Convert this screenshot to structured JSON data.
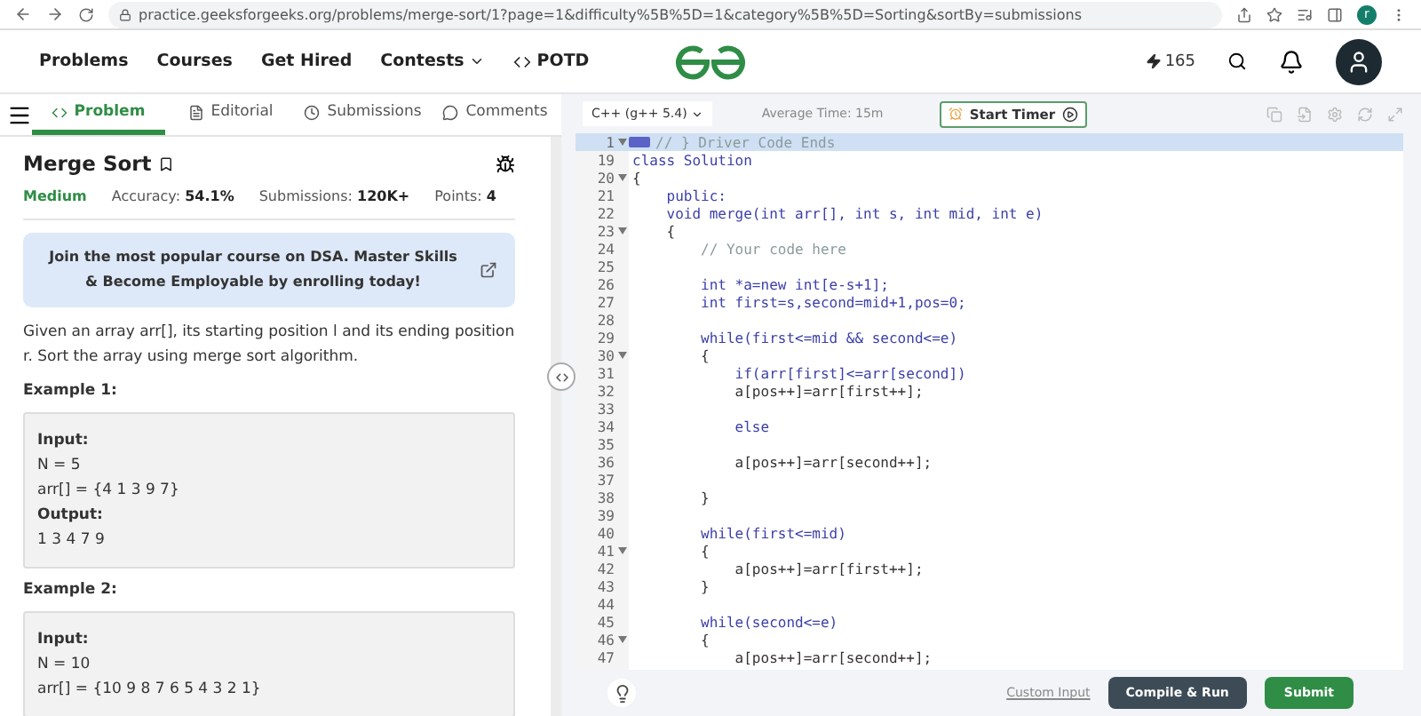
{
  "browser": {
    "url": "practice.geeksforgeeks.org/problems/merge-sort/1?page=1&difficulty%5B%5D=1&category%5B%5D=Sorting&sortBy=submissions",
    "profile_initial": "r"
  },
  "nav": {
    "links": [
      {
        "label": "Problems",
        "kind": "plain"
      },
      {
        "label": "Courses",
        "kind": "plain"
      },
      {
        "label": "Get Hired",
        "kind": "plain"
      },
      {
        "label": "Contests",
        "kind": "dropdown"
      },
      {
        "label": "POTD",
        "kind": "code"
      }
    ],
    "streak": "165"
  },
  "tabs": [
    {
      "label": "Problem",
      "kind": "code",
      "selected": true
    },
    {
      "label": "Editorial",
      "kind": "doc",
      "selected": false
    },
    {
      "label": "Submissions",
      "kind": "clock",
      "selected": false
    },
    {
      "label": "Comments",
      "kind": "chat",
      "selected": false
    }
  ],
  "problem": {
    "title": "Merge Sort",
    "difficulty": "Medium",
    "stats": [
      {
        "label": "Accuracy:",
        "value": "54.1%"
      },
      {
        "label": "Submissions:",
        "value": "120K+"
      },
      {
        "label": "Points:",
        "value": "4"
      }
    ],
    "banner": "Join the most popular course on DSA. Master Skills & Become Employable by enrolling today!",
    "description": "Given an array arr[], its starting position l and its ending position r. Sort the array using merge sort algorithm.",
    "examples": [
      {
        "heading": "Example 1:",
        "lines": [
          {
            "text": "Input:",
            "kind": "label"
          },
          {
            "text": "N = 5",
            "kind": "value"
          },
          {
            "text": "arr[] = {4 1 3 9 7}",
            "kind": "value"
          },
          {
            "text": "Output:",
            "kind": "label"
          },
          {
            "text": "1 3 4 7 9",
            "kind": "value"
          }
        ]
      },
      {
        "heading": "Example 2:",
        "lines": [
          {
            "text": "Input:",
            "kind": "label"
          },
          {
            "text": "N = 10",
            "kind": "value"
          },
          {
            "text": "arr[] = {10 9 8 7 6 5 4 3 2 1}",
            "kind": "value"
          }
        ]
      }
    ]
  },
  "editor": {
    "language": "C++ (g++ 5.4)",
    "average_time": "Average Time: 15m",
    "timer_button": "Start Timer",
    "lines": [
      {
        "number": "1",
        "text": "// } Driver Code Ends",
        "kind": "comment",
        "foldable": true,
        "active": true
      },
      {
        "number": "19",
        "text": "class Solution",
        "kind": "keyword",
        "foldable": false,
        "active": false
      },
      {
        "number": "20",
        "text": "{",
        "kind": "plain",
        "foldable": true,
        "active": false
      },
      {
        "number": "21",
        "text": "    public:",
        "kind": "keyword",
        "foldable": false,
        "active": false
      },
      {
        "number": "22",
        "text": "    void merge(int arr[], int s, int mid, int e)",
        "kind": "keyword",
        "foldable": false,
        "active": false
      },
      {
        "number": "23",
        "text": "    {",
        "kind": "plain",
        "foldable": true,
        "active": false
      },
      {
        "number": "24",
        "text": "        // Your code here",
        "kind": "comment",
        "foldable": false,
        "active": false
      },
      {
        "number": "25",
        "foldable": false,
        "active": false
      },
      {
        "number": "26",
        "text": "        int *a=new int[e-s+1];",
        "kind": "keyword",
        "foldable": false,
        "active": false
      },
      {
        "number": "27",
        "text": "        int first=s,second=mid+1,pos=0;",
        "kind": "keyword",
        "foldable": false,
        "active": false
      },
      {
        "number": "28",
        "foldable": false,
        "active": false
      },
      {
        "number": "29",
        "text": "        while(first<=mid && second<=e)",
        "kind": "keyword",
        "foldable": false,
        "active": false
      },
      {
        "number": "30",
        "text": "        {",
        "kind": "plain",
        "foldable": true,
        "active": false
      },
      {
        "number": "31",
        "text": "            if(arr[first]<=arr[second])",
        "kind": "keyword",
        "foldable": false,
        "active": false
      },
      {
        "number": "32",
        "text": "            a[pos++]=arr[first++];",
        "kind": "plain",
        "foldable": false,
        "active": false
      },
      {
        "number": "33",
        "foldable": false,
        "active": false
      },
      {
        "number": "34",
        "text": "            else",
        "kind": "keyword",
        "foldable": false,
        "active": false
      },
      {
        "number": "35",
        "foldable": false,
        "active": false
      },
      {
        "number": "36",
        "text": "            a[pos++]=arr[second++];",
        "kind": "plain",
        "foldable": false,
        "active": false
      },
      {
        "number": "37",
        "foldable": false,
        "active": false
      },
      {
        "number": "38",
        "text": "        }",
        "kind": "plain",
        "foldable": false,
        "active": false
      },
      {
        "number": "39",
        "foldable": false,
        "active": false
      },
      {
        "number": "40",
        "text": "        while(first<=mid)",
        "kind": "keyword",
        "foldable": false,
        "active": false
      },
      {
        "number": "41",
        "text": "        {",
        "kind": "plain",
        "foldable": true,
        "active": false
      },
      {
        "number": "42",
        "text": "            a[pos++]=arr[first++];",
        "kind": "plain",
        "foldable": false,
        "active": false
      },
      {
        "number": "43",
        "text": "        }",
        "kind": "plain",
        "foldable": false,
        "active": false
      },
      {
        "number": "44",
        "foldable": false,
        "active": false
      },
      {
        "number": "45",
        "text": "        while(second<=e)",
        "kind": "keyword",
        "foldable": false,
        "active": false
      },
      {
        "number": "46",
        "text": "        {",
        "kind": "plain",
        "foldable": true,
        "active": false
      },
      {
        "number": "47",
        "text": "            a[pos++]=arr[second++];",
        "kind": "plain",
        "foldable": false,
        "active": false
      }
    ],
    "custom_input": "Custom Input",
    "compile_button": "Compile & Run",
    "submit_button": "Submit"
  }
}
